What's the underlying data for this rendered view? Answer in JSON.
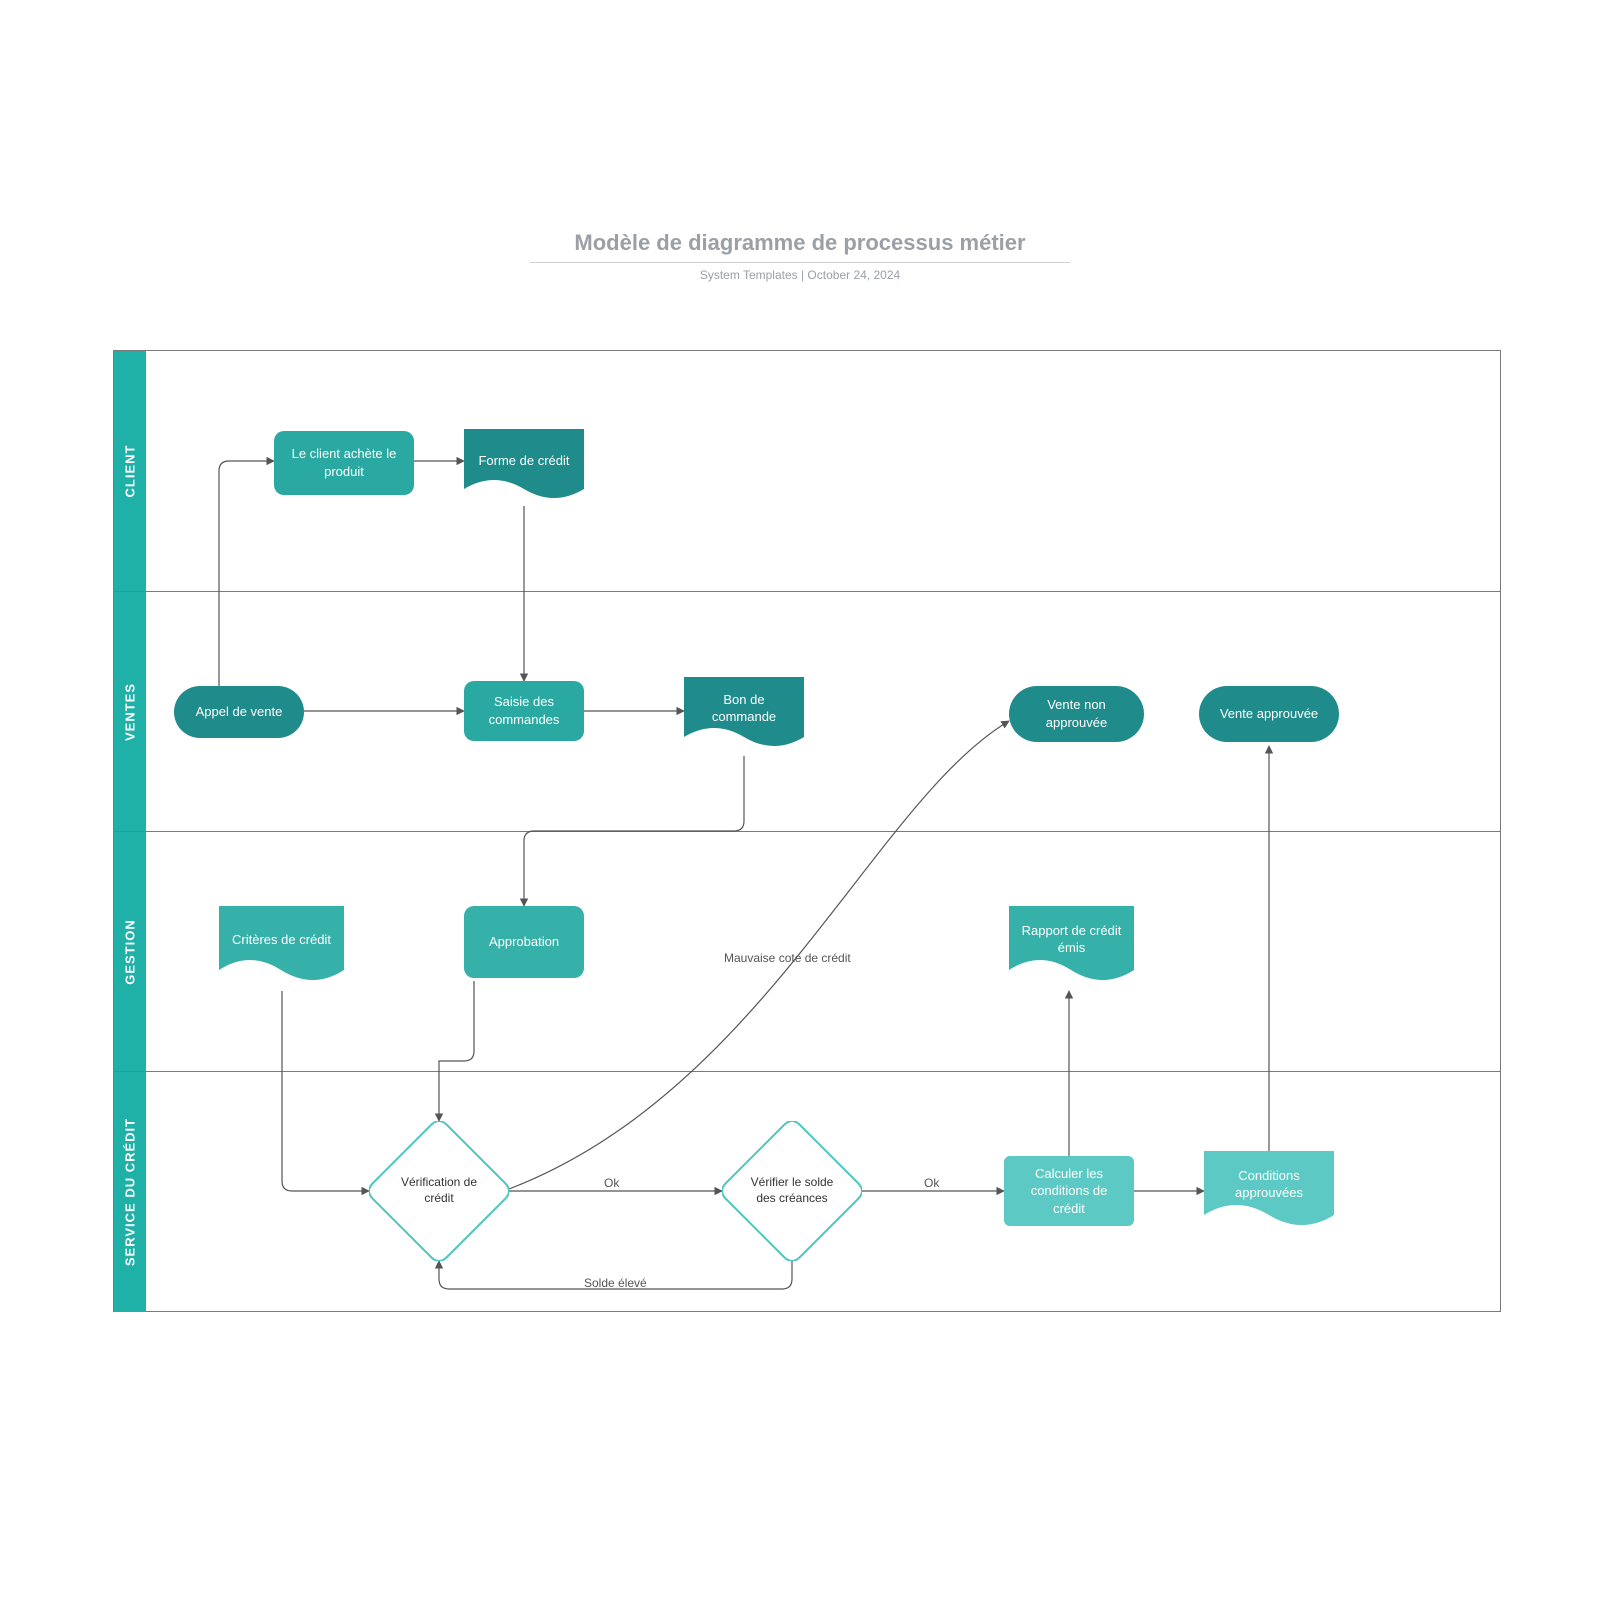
{
  "title": "Modèle de diagramme de processus métier",
  "subtitle": "System Templates  |  October 24, 2024",
  "lanes": {
    "client": "CLIENT",
    "ventes": "VENTES",
    "gestion": "GESTION",
    "credit": "SERVICE DU CRÉDIT"
  },
  "nodes": {
    "appel": "Appel de vente",
    "achete": "Le client achète le produit",
    "formeCredit": "Forme de crédit",
    "saisie": "Saisie des commandes",
    "bonCmd": "Bon de commande",
    "venteNon": "Vente non approuvée",
    "venteApp": "Vente approuvée",
    "criteres": "Critères de crédit",
    "approb": "Approbation",
    "rapport": "Rapport de crédit émis",
    "verifCredit": "Vérification de crédit",
    "verifSolde": "Vérifier le solde des créances",
    "calculer": "Calculer les conditions de crédit",
    "conditions": "Conditions approuvées"
  },
  "edges": {
    "ok1": "Ok",
    "ok2": "Ok",
    "mauvaise": "Mauvaise cote de crédit",
    "solde": "Solde élevé"
  }
}
